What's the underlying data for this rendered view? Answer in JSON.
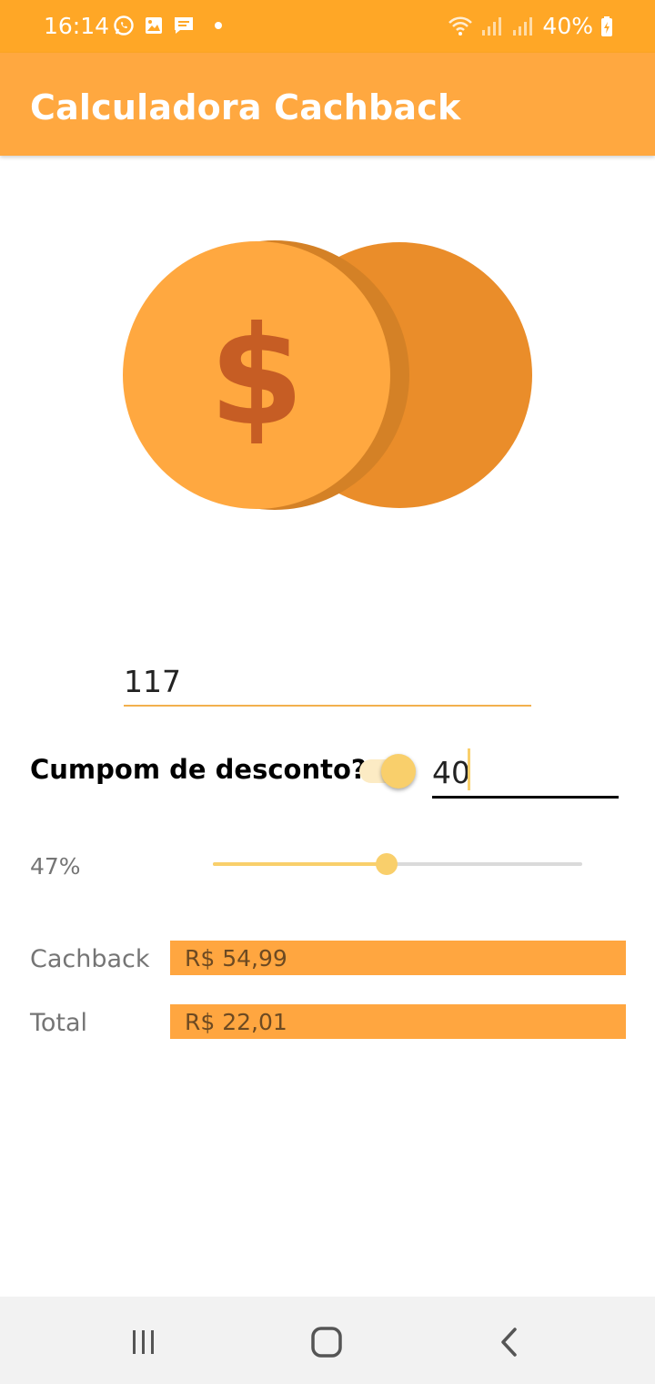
{
  "status_bar": {
    "time": "16:14",
    "battery": "40%",
    "left_icons": [
      "whatsapp-icon",
      "gallery-icon",
      "message-icon",
      "notification-dot"
    ],
    "right_icons": [
      "wifi-icon",
      "signal-icon",
      "signal-icon",
      "battery-charging-icon"
    ]
  },
  "app_bar": {
    "title": "Calculadora Cachback"
  },
  "colors": {
    "primary": "#FFA840",
    "accent": "#F9CF6B",
    "coin_front": "#FFA840",
    "coin_back": "#EA8D2A",
    "dollar": "#C65D24"
  },
  "form": {
    "value": "117",
    "coupon_label": "Cumpom de desconto?",
    "coupon_enabled": true,
    "coupon_value": "40",
    "percent_label": "47%",
    "percent": 0.47
  },
  "results": {
    "cashback_label": "Cachback",
    "cashback_value": "R$ 54,99",
    "total_label": "Total",
    "total_value": "R$ 22,01"
  },
  "nav": [
    "recent-apps-icon",
    "home-icon",
    "back-icon"
  ]
}
